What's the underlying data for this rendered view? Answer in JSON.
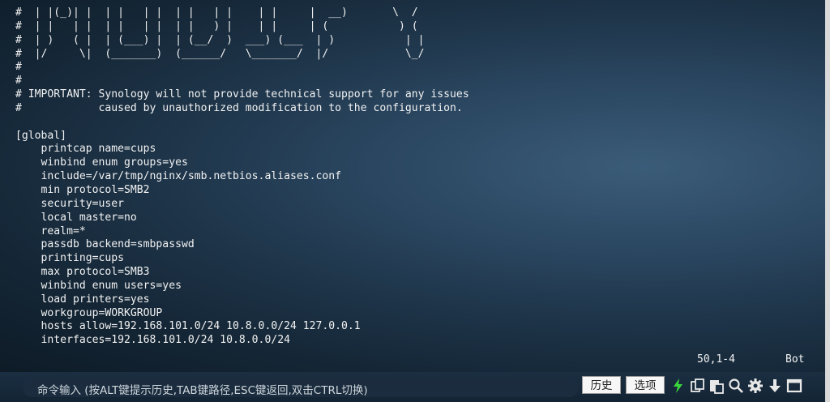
{
  "terminal": {
    "lines": [
      "#  | |(_)| |  | |   | |  | |   | |    | |     |  __)       \\  /",
      "#  | |   | |  | |   | |  | |   ) |    | |     | (           ) (",
      "#  | )   ( |  | (___) |  | (__/  )  ___) (___  | )           | |",
      "#  |/     \\|  (_______)  (______/   \\_______/  |/            \\_/",
      "#",
      "#",
      "# IMPORTANT: Synology will not provide technical support for any issues",
      "#            caused by unauthorized modification to the configuration.",
      "",
      "[global]",
      "    printcap name=cups",
      "    winbind enum groups=yes",
      "    include=/var/tmp/nginx/smb.netbios.aliases.conf",
      "    min protocol=SMB2",
      "    security=user",
      "    local master=no",
      "    realm=*",
      "    passdb backend=smbpasswd",
      "    printing=cups",
      "    max protocol=SMB3",
      "    winbind enum users=yes",
      "    load printers=yes",
      "    workgroup=WORKGROUP",
      "    hosts allow=192.168.101.0/24 10.8.0.0/24 127.0.0.1",
      "    interfaces=192.168.101.0/24 10.8.0.0/24"
    ],
    "status_position": "50,1-4",
    "status_mode": "Bot"
  },
  "command_bar": {
    "placeholder": "命令输入 (按ALT键提示历史,TAB键路径,ESC键返回,双击CTRL切换)",
    "history_label": "历史",
    "options_label": "选项",
    "icons": [
      "lightning-icon",
      "copy-icon",
      "paste-icon",
      "search-icon",
      "gear-icon",
      "download-icon",
      "maximize-icon"
    ],
    "accent_color": "#3bd63b"
  }
}
